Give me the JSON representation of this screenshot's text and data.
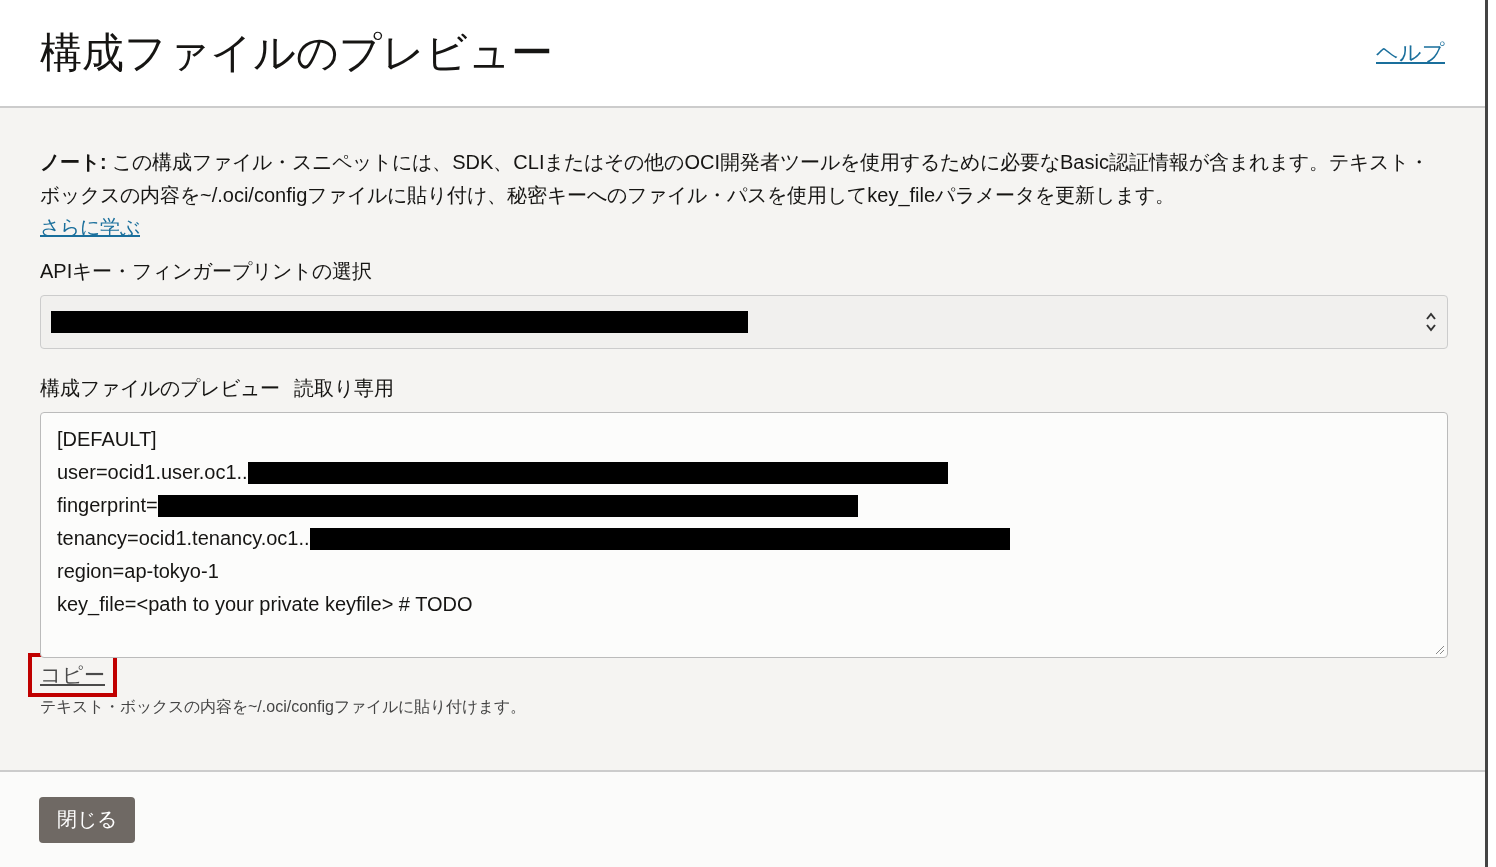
{
  "dialog": {
    "title": "構成ファイルのプレビュー",
    "help_link": "ヘルプ"
  },
  "note": {
    "label": "ノート:",
    "text": "この構成ファイル・スニペットには、SDK、CLIまたはその他のOCI開発者ツールを使用するために必要なBasic認証情報が含まれます。テキスト・ボックスの内容を~/.oci/configファイルに貼り付け、秘密キーへのファイル・パスを使用してkey_fileパラメータを更新します。",
    "link": "さらに学ぶ"
  },
  "fingerprint_select": {
    "label": "APIキー・フィンガープリントの選択",
    "redacted": true
  },
  "preview": {
    "label": "構成ファイルのプレビュー",
    "badge": "読取り専用",
    "lines": [
      {
        "text": "[DEFAULT]",
        "redacted": false
      },
      {
        "text": "user=ocid1.user.oc1..",
        "redacted": true
      },
      {
        "text": "fingerprint=",
        "redacted": true
      },
      {
        "text": "tenancy=ocid1.tenancy.oc1..",
        "redacted": true
      },
      {
        "text": "region=ap-tokyo-1",
        "redacted": false
      },
      {
        "text": "key_file=<path to your private keyfile> # TODO",
        "redacted": false
      }
    ]
  },
  "copy": {
    "label": "コピー",
    "highlighted": true,
    "hint": "テキスト・ボックスの内容を~/.oci/configファイルに貼り付けます。"
  },
  "footer": {
    "buttons": [
      "閉じる"
    ]
  }
}
